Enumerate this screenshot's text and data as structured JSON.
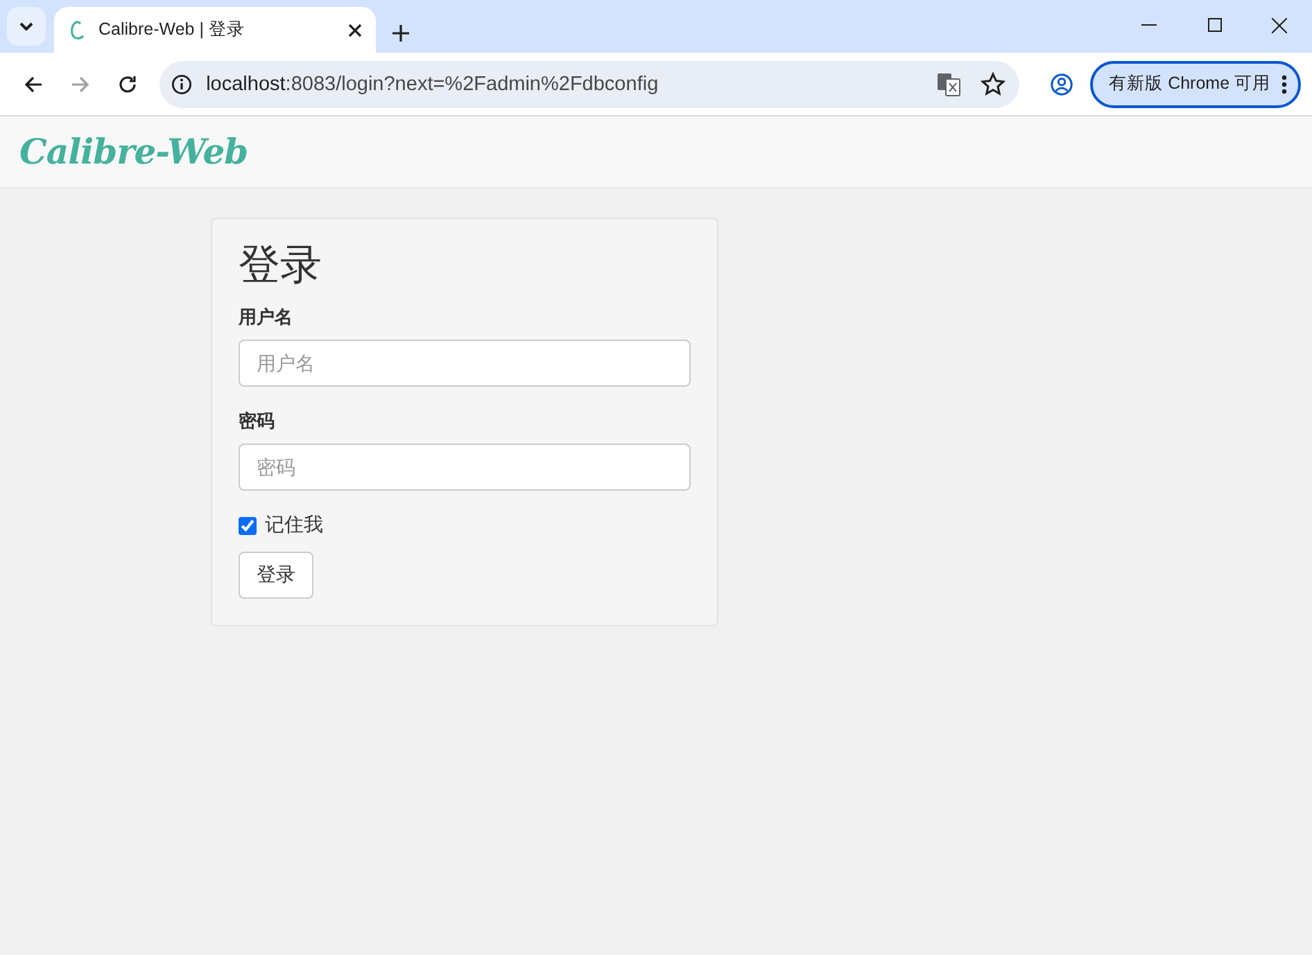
{
  "browser": {
    "tab_title": "Calibre-Web | 登录",
    "url_host": "localhost",
    "url_rest": ":8083/login?next=%2Fadmin%2Fdbconfig",
    "update_button": "有新版 Chrome 可用"
  },
  "navbar": {
    "brand": "Calibre-Web"
  },
  "login": {
    "title": "登录",
    "fields": [
      {
        "label": "用户名",
        "placeholder": "用户名"
      },
      {
        "label": "密码",
        "placeholder": "密码"
      }
    ],
    "remember": {
      "label": "记住我",
      "checked": true
    },
    "submit": "登录"
  }
}
